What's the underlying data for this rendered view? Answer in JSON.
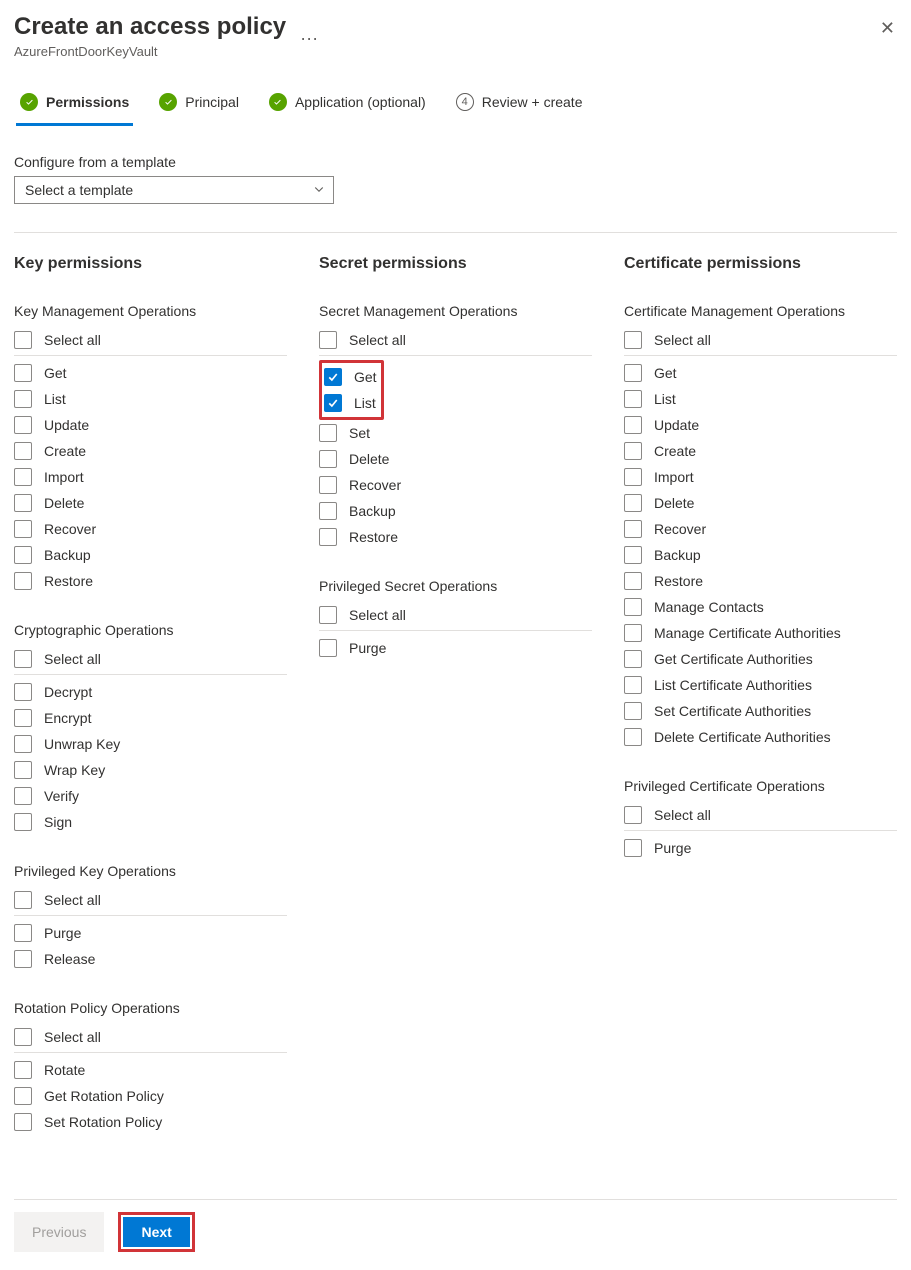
{
  "header": {
    "title": "Create an access policy",
    "subtitle": "AzureFrontDoorKeyVault"
  },
  "steps": [
    {
      "label": "Permissions",
      "state": "done",
      "active": true
    },
    {
      "label": "Principal",
      "state": "done",
      "active": false
    },
    {
      "label": "Application (optional)",
      "state": "done",
      "active": false
    },
    {
      "label": "Review + create",
      "state": "number",
      "num": "4",
      "active": false
    }
  ],
  "template": {
    "label": "Configure from a template",
    "placeholder": "Select a template"
  },
  "columns": {
    "key": {
      "title": "Key permissions",
      "groups": [
        {
          "title": "Key Management Operations",
          "selectAll": "Select all",
          "items": [
            {
              "label": "Get"
            },
            {
              "label": "List"
            },
            {
              "label": "Update"
            },
            {
              "label": "Create"
            },
            {
              "label": "Import"
            },
            {
              "label": "Delete"
            },
            {
              "label": "Recover"
            },
            {
              "label": "Backup"
            },
            {
              "label": "Restore"
            }
          ]
        },
        {
          "title": "Cryptographic Operations",
          "selectAll": "Select all",
          "items": [
            {
              "label": "Decrypt"
            },
            {
              "label": "Encrypt"
            },
            {
              "label": "Unwrap Key"
            },
            {
              "label": "Wrap Key"
            },
            {
              "label": "Verify"
            },
            {
              "label": "Sign"
            }
          ]
        },
        {
          "title": "Privileged Key Operations",
          "selectAll": "Select all",
          "items": [
            {
              "label": "Purge"
            },
            {
              "label": "Release"
            }
          ]
        },
        {
          "title": "Rotation Policy Operations",
          "selectAll": "Select all",
          "items": [
            {
              "label": "Rotate"
            },
            {
              "label": "Get Rotation Policy"
            },
            {
              "label": "Set Rotation Policy"
            }
          ]
        }
      ]
    },
    "secret": {
      "title": "Secret permissions",
      "groups": [
        {
          "title": "Secret Management Operations",
          "selectAll": "Select all",
          "highlight": true,
          "items": [
            {
              "label": "Get",
              "checked": true
            },
            {
              "label": "List",
              "checked": true
            },
            {
              "label": "Set"
            },
            {
              "label": "Delete"
            },
            {
              "label": "Recover"
            },
            {
              "label": "Backup"
            },
            {
              "label": "Restore"
            }
          ]
        },
        {
          "title": "Privileged Secret Operations",
          "selectAll": "Select all",
          "items": [
            {
              "label": "Purge"
            }
          ]
        }
      ]
    },
    "cert": {
      "title": "Certificate permissions",
      "groups": [
        {
          "title": "Certificate Management Operations",
          "selectAll": "Select all",
          "items": [
            {
              "label": "Get"
            },
            {
              "label": "List"
            },
            {
              "label": "Update"
            },
            {
              "label": "Create"
            },
            {
              "label": "Import"
            },
            {
              "label": "Delete"
            },
            {
              "label": "Recover"
            },
            {
              "label": "Backup"
            },
            {
              "label": "Restore"
            },
            {
              "label": "Manage Contacts"
            },
            {
              "label": "Manage Certificate Authorities"
            },
            {
              "label": "Get Certificate Authorities"
            },
            {
              "label": "List Certificate Authorities"
            },
            {
              "label": "Set Certificate Authorities"
            },
            {
              "label": "Delete Certificate Authorities"
            }
          ]
        },
        {
          "title": "Privileged Certificate Operations",
          "selectAll": "Select all",
          "items": [
            {
              "label": "Purge"
            }
          ]
        }
      ]
    }
  },
  "footer": {
    "previous": "Previous",
    "next": "Next"
  }
}
